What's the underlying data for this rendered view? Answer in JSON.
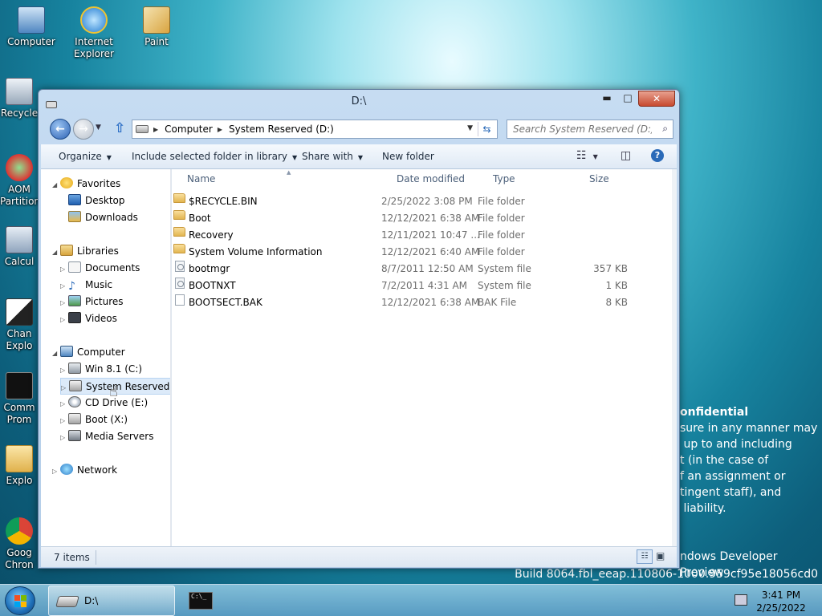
{
  "desktop": {
    "icons": [
      {
        "label": "Computer"
      },
      {
        "label": "Internet Explorer"
      },
      {
        "label": "Paint"
      },
      {
        "label": "Recycle"
      },
      {
        "label": "AOM Partition"
      },
      {
        "label": "Calcul"
      },
      {
        "label": "Chan Explo"
      },
      {
        "label": "Comm Prom"
      },
      {
        "label": "Explo"
      },
      {
        "label": "Goog Chron"
      }
    ],
    "watermark": {
      "heading": "onfidential",
      "lines": [
        "sure in any manner may",
        " up to and including",
        "t (in the case of",
        "f an assignment or",
        "tingent staff), and",
        " liability."
      ],
      "preview": "ndows Developer Preview",
      "build": "Build 8064.fbl_eeap.110806-1000.959cf95e18056cd0"
    }
  },
  "window": {
    "title": "D:\\",
    "controls": {
      "minimize": "▬",
      "maximize": "□",
      "close": "✕"
    },
    "address": {
      "crumbs": [
        "Computer",
        "System Reserved (D:)"
      ]
    },
    "search": {
      "placeholder": "Search System Reserved (D:)"
    },
    "toolbar": {
      "organize": "Organize",
      "include": "Include selected folder in library",
      "share": "Share with",
      "new_folder": "New folder"
    },
    "nav_tree": {
      "favorites": {
        "label": "Favorites",
        "items": [
          "Desktop",
          "Downloads"
        ]
      },
      "libraries": {
        "label": "Libraries",
        "items": [
          "Documents",
          "Music",
          "Pictures",
          "Videos"
        ]
      },
      "computer": {
        "label": "Computer",
        "items": [
          "Win 8.1 (C:)",
          "System Reserved (D:",
          "CD Drive (E:)",
          "Boot (X:)",
          "Media Servers"
        ]
      },
      "network": {
        "label": "Network"
      }
    },
    "columns": {
      "name": "Name",
      "date": "Date modified",
      "type": "Type",
      "size": "Size"
    },
    "files": [
      {
        "name": "$RECYCLE.BIN",
        "date": "2/25/2022 3:08 PM",
        "type": "File folder",
        "size": "",
        "icon": "folder-icon"
      },
      {
        "name": "Boot",
        "date": "12/12/2021 6:38 AM",
        "type": "File folder",
        "size": "",
        "icon": "folder-icon"
      },
      {
        "name": "Recovery",
        "date": "12/11/2021 10:47 ...",
        "type": "File folder",
        "size": "",
        "icon": "folder-icon"
      },
      {
        "name": "System Volume Information",
        "date": "12/12/2021 6:40 AM",
        "type": "File folder",
        "size": "",
        "icon": "folder-icon"
      },
      {
        "name": "bootmgr",
        "date": "8/7/2011 12:50 AM",
        "type": "System file",
        "size": "357 KB",
        "icon": "system-file-icon"
      },
      {
        "name": "BOOTNXT",
        "date": "7/2/2011 4:31 AM",
        "type": "System file",
        "size": "1 KB",
        "icon": "system-file-icon"
      },
      {
        "name": "BOOTSECT.BAK",
        "date": "12/12/2021 6:38 AM",
        "type": "BAK File",
        "size": "8 KB",
        "icon": "file-icon"
      }
    ],
    "status": {
      "item_count": "7 items"
    }
  },
  "taskbar": {
    "explorer_label": "D:\\",
    "cmd_glyph": "C:\\_",
    "clock": {
      "time": "3:41 PM",
      "date": "2/25/2022"
    }
  }
}
